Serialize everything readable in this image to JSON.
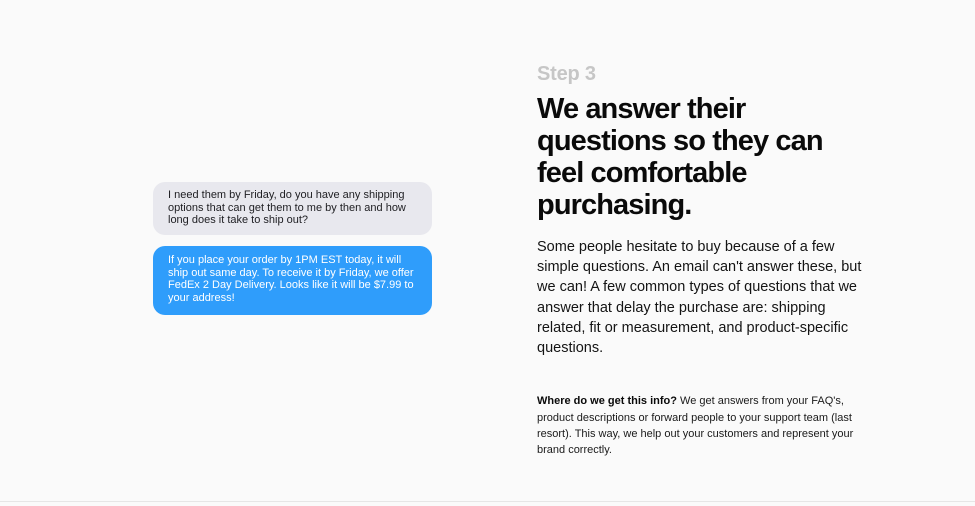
{
  "chat": {
    "incoming_message": "I need them by Friday, do you have any shipping options that can get them to me by then and how long does it take to ship out?",
    "outgoing_message": "If you place your order by 1PM EST today, it will ship out same day. To receive it by Friday, we offer FedEx 2 Day Delivery. Looks like it will be $7.99 to your address!",
    "colors": {
      "incoming_bubble": "#e8e8ee",
      "outgoing_bubble": "#2f9dfb"
    }
  },
  "section": {
    "step_label": "Step 3",
    "headline": "We answer their questions so they can feel comfortable purchasing.",
    "body": "Some people hesitate to buy because of a few simple questions. An email can't answer these, but we can! A few common types of questions that we answer that delay the purchase are: shipping related, fit or measurement, and product-specific questions.",
    "note_strong": "Where do we get this info?",
    "note_text": " We get answers from your FAQ's, product descriptions or forward people to your support team (last resort). This way, we help out your customers and represent your brand correctly."
  }
}
